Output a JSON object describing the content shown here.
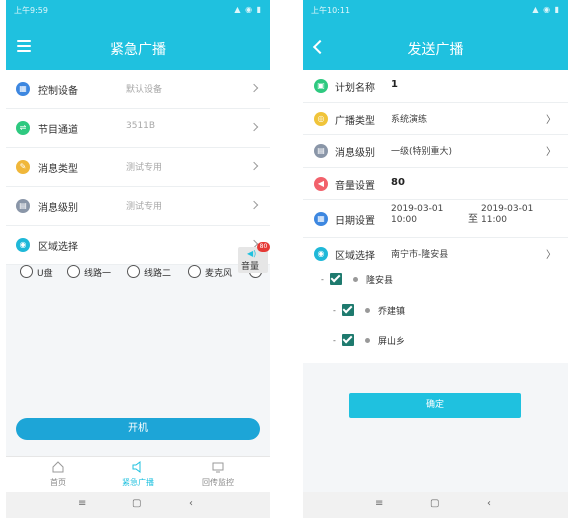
{
  "left": {
    "status_time": "上午9:59",
    "status_icons": "▲ ◉ ▮",
    "title": "紧急广播",
    "rows": [
      {
        "label": "控制设备",
        "value": "默认设备",
        "icon": "device-icon",
        "color": "#3d87e0",
        "glyph": "▦"
      },
      {
        "label": "节目通道",
        "value": "3511B",
        "icon": "channel-icon",
        "color": "#2ec980",
        "glyph": "⇌"
      },
      {
        "label": "消息类型",
        "value": "测试专用",
        "icon": "message-type-icon",
        "color": "#f0b73a",
        "glyph": "✎"
      },
      {
        "label": "消息级别",
        "value": "测试专用",
        "icon": "message-level-icon",
        "color": "#8a96a8",
        "glyph": "▤"
      },
      {
        "label": "区域选择",
        "value": "",
        "icon": "location-icon",
        "color": "#1fb8d8",
        "glyph": "◉"
      }
    ],
    "radios": [
      "U盘",
      "线路一",
      "线路二",
      "麦克风"
    ],
    "volume": {
      "label": "音量",
      "badge": "80"
    },
    "power_button": "开机",
    "tabs": [
      {
        "label": "首页",
        "icon": "home-icon"
      },
      {
        "label": "紧急广播",
        "icon": "broadcast-icon"
      },
      {
        "label": "回传监控",
        "icon": "monitor-icon"
      }
    ],
    "nav": {
      "menu": "≡",
      "home": "▢",
      "back": "‹"
    }
  },
  "right": {
    "status_time": "上午10:11",
    "status_icons": "▲ ◉ ▮",
    "title": "发送广播",
    "plan_name": {
      "label": "计划名称",
      "value": "1"
    },
    "broadcast_type": {
      "label": "广播类型",
      "value": "系统演练"
    },
    "message_level": {
      "label": "消息级别",
      "value": "一级(特别重大)"
    },
    "volume": {
      "label": "音量设置",
      "value": "80"
    },
    "date": {
      "label": "日期设置",
      "start_date": "2019-03-01",
      "start_time": "10:00",
      "to": "至",
      "end_date": "2019-03-01",
      "end_time": "11:00"
    },
    "region": {
      "label": "区域选择",
      "value": "南宁市-隆安县"
    },
    "paren": "〉",
    "tree": [
      "隆安县",
      "乔建镇",
      "屏山乡"
    ],
    "confirm_button": "确定",
    "nav": {
      "menu": "≡",
      "home": "▢",
      "back": "‹"
    }
  }
}
